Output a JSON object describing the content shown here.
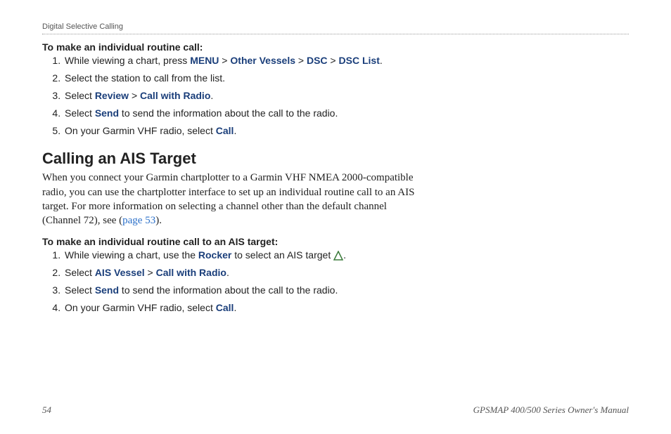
{
  "header": {
    "section": "Digital Selective Calling"
  },
  "block1": {
    "heading": "To make an individual routine call:",
    "steps": {
      "s1a": "While viewing a chart, press ",
      "s1_menu": "MENU",
      "s1_gt1": " > ",
      "s1_other": "Other Vessels",
      "s1_gt2": " > ",
      "s1_dsc": "DSC",
      "s1_gt3": " > ",
      "s1_dsclist": "DSC List",
      "s1_end": ".",
      "s2": "Select the station to call from the list.",
      "s3a": "Select ",
      "s3_review": "Review",
      "s3_gt": " > ",
      "s3_call": "Call with Radio",
      "s3_end": ".",
      "s4a": "Select ",
      "s4_send": "Send",
      "s4b": " to send the information about the call to the radio.",
      "s5a": "On your Garmin VHF radio, select ",
      "s5_call": "Call",
      "s5_end": "."
    }
  },
  "section2": {
    "title": "Calling an AIS Target",
    "para_a": "When you connect your Garmin chartplotter to a Garmin VHF NMEA 2000-compatible radio, you can use the chartplotter interface to set up an individual routine call to an AIS target. For more information on selecting a channel other than the default channel (Channel 72), see (",
    "para_link": "page 53",
    "para_b": ")."
  },
  "block2": {
    "heading": "To make an individual routine call to an AIS target:",
    "steps": {
      "s1a": "While viewing a chart, use the ",
      "s1_rocker": "Rocker",
      "s1b": " to select an AIS target ",
      "s1_end": ".",
      "s2a": "Select ",
      "s2_ais": "AIS Vessel",
      "s2_gt": " > ",
      "s2_call": "Call with Radio",
      "s2_end": ".",
      "s3a": "Select ",
      "s3_send": "Send",
      "s3b": " to send the information about the call to the radio.",
      "s4a": "On your Garmin VHF radio, select ",
      "s4_call": "Call",
      "s4_end": "."
    }
  },
  "footer": {
    "page": "54",
    "manual": "GPSMAP 400/500 Series Owner's Manual"
  }
}
